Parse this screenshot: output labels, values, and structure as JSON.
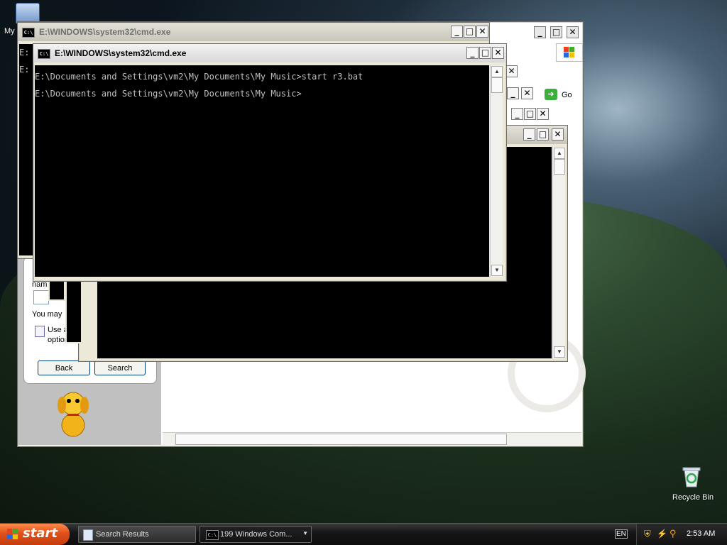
{
  "desktop": {
    "my_computer_label": "My",
    "recycle_bin_label": "Recycle Bin"
  },
  "cmd_back": {
    "title": "E:\\WINDOWS\\system32\\cmd.exe",
    "prompt_stubs": [
      "E:",
      "E:"
    ]
  },
  "cmd_front": {
    "title": "E:\\WINDOWS\\system32\\cmd.exe",
    "lines": [
      "E:\\Documents and Settings\\vm2\\My Documents\\My Music>start r3.bat",
      "E:\\Documents and Settings\\vm2\\My Documents\\My Music>"
    ]
  },
  "search_window": {
    "go_label": "Go",
    "name_label": "nam",
    "you_may_label": "You may",
    "use_advanced_label": "Use adva",
    "options_label": "options",
    "back_button": "Back",
    "search_button": "Search"
  },
  "taskbar": {
    "start_label": "start",
    "tasks": [
      {
        "label": "Search Results"
      },
      {
        "label": "199 Windows Com..."
      }
    ],
    "language": "EN",
    "clock": "2:53 AM"
  },
  "icons": {
    "cmd": "console-icon",
    "minimize": "minimize-icon",
    "maximize": "maximize-icon",
    "close": "close-icon",
    "go": "go-arrow-icon",
    "dog": "search-dog-icon",
    "recycle": "recycle-bin-icon",
    "windows_flag": "windows-flag-icon"
  },
  "colors": {
    "console_bg": "#000000",
    "console_text": "#c0c0c0",
    "start_orange": "#e0511a"
  }
}
